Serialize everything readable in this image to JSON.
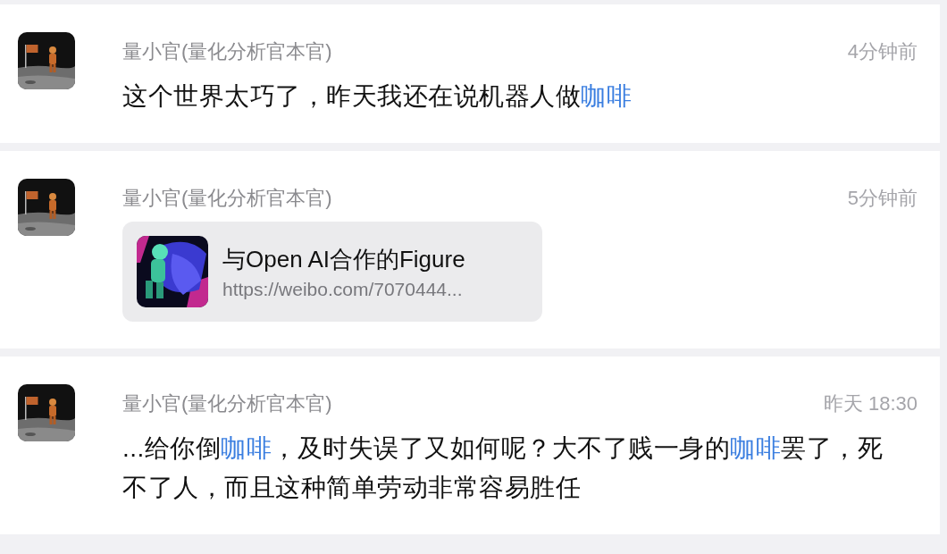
{
  "posts": [
    {
      "author": "量小官(量化分析官本官)",
      "time": "4分钟前",
      "kind": "text",
      "message": [
        {
          "text": "这个世界太巧了，昨天我还在说机器人做",
          "keyword": false
        },
        {
          "text": "咖啡",
          "keyword": true
        }
      ]
    },
    {
      "author": "量小官(量化分析官本官)",
      "time": "5分钟前",
      "kind": "link",
      "link": {
        "title": "与Open AI合作的Figure",
        "url": "https://weibo.com/7070444..."
      }
    },
    {
      "author": "量小官(量化分析官本官)",
      "time": "昨天 18:30",
      "kind": "text",
      "message": [
        {
          "text": "...给你倒",
          "keyword": false
        },
        {
          "text": "咖啡",
          "keyword": true
        },
        {
          "text": "，及时失误了又如何呢？大不了贱一身的",
          "keyword": false
        },
        {
          "text": "咖啡",
          "keyword": true
        },
        {
          "text": "罢了，死不了人，而且这种简单劳动非常容易胜任",
          "keyword": false
        }
      ]
    }
  ]
}
